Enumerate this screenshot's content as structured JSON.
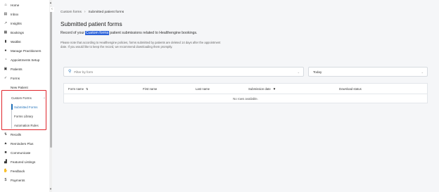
{
  "sidebar": {
    "items": [
      {
        "label": "Home",
        "icon": "home-icon",
        "glyph": "⌂"
      },
      {
        "label": "Inbox",
        "icon": "inbox-icon",
        "glyph": "▤"
      },
      {
        "label": "Insights",
        "icon": "insights-icon",
        "glyph": "↗"
      },
      {
        "label": "Bookings",
        "icon": "bookings-icon",
        "glyph": "▦"
      },
      {
        "label": "Waitlist",
        "icon": "waitlist-icon",
        "glyph": "▮"
      },
      {
        "label": "Manage Practitioners",
        "icon": "practitioners-icon",
        "glyph": "●"
      },
      {
        "label": "Appointments Setup",
        "icon": "appointments-icon",
        "glyph": "◔"
      },
      {
        "label": "Patients",
        "icon": "patients-icon",
        "glyph": "▣"
      },
      {
        "label": "Forms",
        "icon": "forms-icon",
        "glyph": "✓"
      },
      {
        "label": "New Patient",
        "icon": "",
        "glyph": ""
      },
      {
        "label": "Recalls",
        "icon": "recalls-icon",
        "glyph": "⇅"
      },
      {
        "label": "Reminders Plus",
        "icon": "reminders-icon",
        "glyph": "▲"
      },
      {
        "label": "Communicate",
        "icon": "communicate-icon",
        "glyph": "■"
      },
      {
        "label": "Featured Listings",
        "icon": "listings-icon",
        "glyph": "▟"
      },
      {
        "label": "Feedback",
        "icon": "feedback-icon",
        "glyph": "✋"
      },
      {
        "label": "Payments",
        "icon": "payments-icon",
        "glyph": "$"
      }
    ],
    "custom_forms": {
      "label": "Custom Forms",
      "chevron": "^",
      "children": [
        {
          "label": "Submitted Forms",
          "active": true
        },
        {
          "label": "Forms Library",
          "active": false
        },
        {
          "label": "Automation Rules",
          "active": false
        }
      ]
    },
    "collapse_glyph": "‹",
    "highlight_color": "#e0252b"
  },
  "breadcrumb": {
    "parent": "Custom forms",
    "separator": "›",
    "current": "Submitted patient forms"
  },
  "page": {
    "title": "Submitted patient forms",
    "intro_before": "Record of your ",
    "intro_highlight": "Custom forms",
    "intro_after": " patient submissions related to Healthengine bookings.",
    "note": "Please note that according to Healthengine policies, forms submitted by patients are deleted 14 days after the appointment date. If you would like to keep the record, we recommend downloading them promptly."
  },
  "filters": {
    "form_placeholder": "Filter by form",
    "date_value": "Today",
    "chevron": "⌄"
  },
  "table": {
    "columns": [
      {
        "label": "Form name",
        "sort": "⇅"
      },
      {
        "label": "First name",
        "sort": ""
      },
      {
        "label": "Last name",
        "sort": ""
      },
      {
        "label": "Submission date",
        "sort": "▼"
      },
      {
        "label": "Download status",
        "sort": ""
      }
    ],
    "empty_message": "No rows available."
  },
  "colors": {
    "accent": "#1d6fb8",
    "highlight": "#2b62d9"
  }
}
